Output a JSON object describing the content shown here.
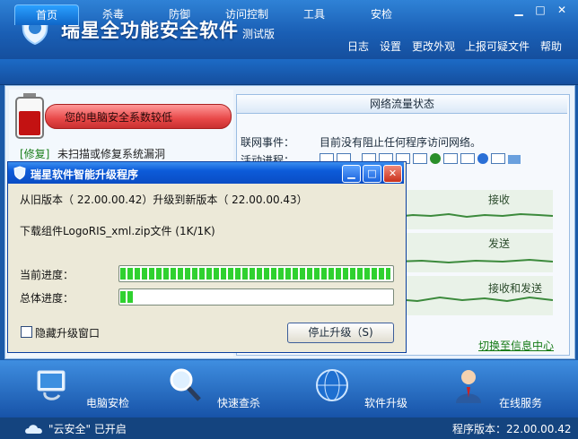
{
  "app": {
    "title": "瑞星全功能安全软件",
    "subtitle": "测试版",
    "menu": [
      "日志",
      "设置",
      "更改外观",
      "上报可疑文件",
      "帮助"
    ]
  },
  "tabs": [
    "首页",
    "杀毒",
    "防御",
    "访问控制",
    "工具",
    "安检"
  ],
  "active_tab": "首页",
  "left": {
    "warning": "您的电脑安全系数较低",
    "fix_link": "[修复]",
    "fix_text": "未扫描或修复系统漏洞"
  },
  "network": {
    "header": "网络流量状态",
    "label_events": "联网事件：",
    "events_value": "目前没有阻止任何程序访问网络。",
    "label_processes": "活动进程：",
    "graphs": [
      "接收",
      "发送",
      "接收和发送"
    ],
    "info_link": "切换至信息中心"
  },
  "dialog": {
    "title": "瑞星软件智能升级程序",
    "version_line": "从旧版本（ 22.00.00.42）升级到新版本（ 22.00.00.43）",
    "download_line": "下载组件LogoRIS_xml.zip文件 (1K/1K)",
    "current_label": "当前进度：",
    "total_label": "总体进度：",
    "current_progress": 1.0,
    "total_progress": 0.05,
    "hide_label": "隐藏升级窗口",
    "stop_button": "停止升级（S)"
  },
  "toolbar": [
    {
      "label": "电脑安检",
      "icon": "stethoscope-monitor-icon"
    },
    {
      "label": "快速查杀",
      "icon": "magnifier-icon"
    },
    {
      "label": "软件升级",
      "icon": "globe-icon"
    },
    {
      "label": "在线服务",
      "icon": "support-agent-icon"
    }
  ],
  "status": {
    "cloud": "\"云安全\" 已开启",
    "version": "程序版本：22.00.00.42"
  },
  "colors": {
    "brand_blue": "#1a5fb5",
    "warning_red": "#e84848",
    "progress_green": "#2fd12f",
    "link_green": "#147a14"
  }
}
